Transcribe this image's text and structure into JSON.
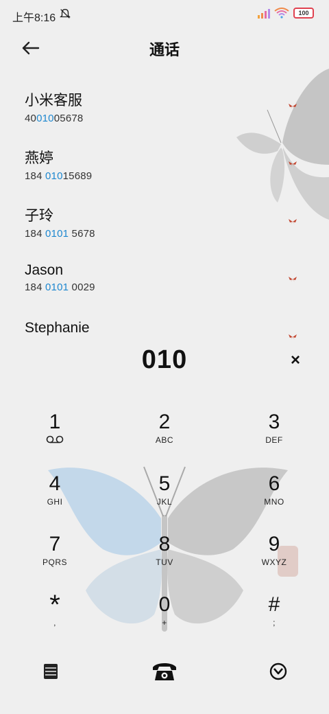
{
  "status": {
    "time": "上午8:16",
    "battery": "100"
  },
  "header": {
    "title": "通话"
  },
  "contacts": [
    {
      "name": "小米客服",
      "num_pre": "40",
      "num_hl": "010",
      "num_post": "05678"
    },
    {
      "name": "燕婷",
      "num_pre": "184 ",
      "num_hl": "010",
      "num_post": "15689"
    },
    {
      "name": "子玲",
      "num_pre": "184 ",
      "num_hl": "0101",
      "num_post": " 5678"
    },
    {
      "name": "Jason",
      "num_pre": "184 ",
      "num_hl": "0101",
      "num_post": " 0029"
    },
    {
      "name": "Stephanie"
    }
  ],
  "dialer": {
    "input": "010",
    "clear_label": "×",
    "keys": [
      {
        "digit": "1",
        "letters": ""
      },
      {
        "digit": "2",
        "letters": "ABC"
      },
      {
        "digit": "3",
        "letters": "DEF"
      },
      {
        "digit": "4",
        "letters": "GHI"
      },
      {
        "digit": "5",
        "letters": "JKL"
      },
      {
        "digit": "6",
        "letters": "MNO"
      },
      {
        "digit": "7",
        "letters": "PQRS"
      },
      {
        "digit": "8",
        "letters": "TUV"
      },
      {
        "digit": "9",
        "letters": "WXYZ"
      },
      {
        "digit": "*",
        "letters": ","
      },
      {
        "digit": "0",
        "letters": "+"
      },
      {
        "digit": "#",
        "letters": ";"
      }
    ]
  },
  "colors": {
    "accent": "#1e88d0",
    "background": "#efefef",
    "text": "#111111"
  },
  "icons": {
    "back": "arrow-left-icon",
    "voicemail": "voicemail-icon",
    "menu": "menu-icon",
    "call": "phone-icon",
    "dialpad_toggle": "dialpad-toggle-icon"
  }
}
